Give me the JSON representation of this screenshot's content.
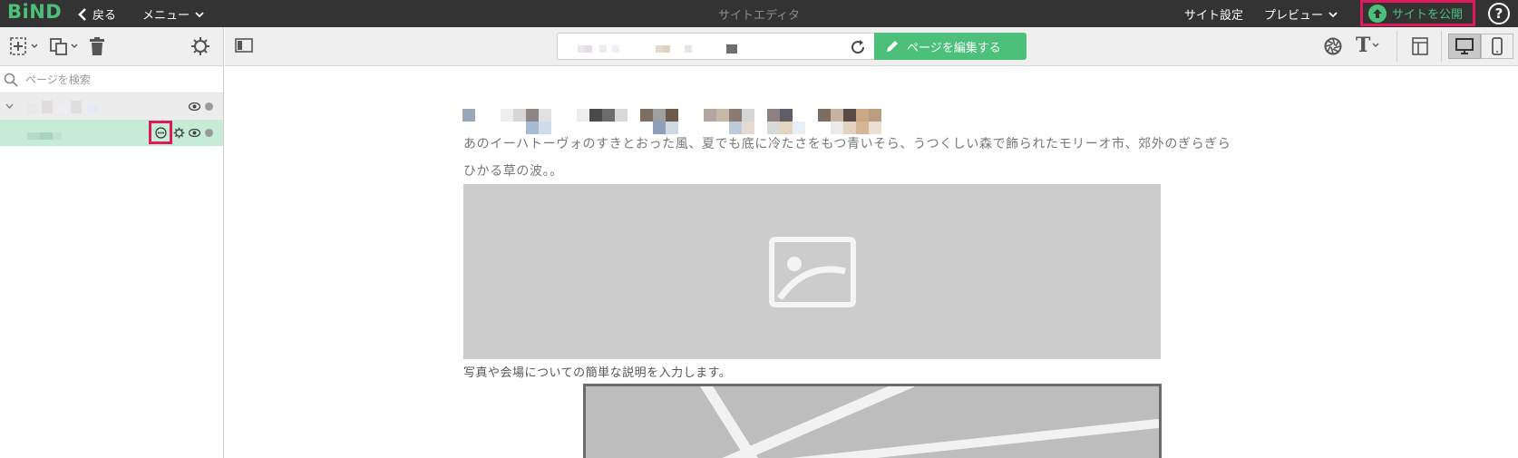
{
  "topbar": {
    "logo": "BiND",
    "back_label": "戻る",
    "menu_label": "メニュー",
    "app_title": "サイトエディタ",
    "site_settings_label": "サイト設定",
    "preview_label": "プレビュー",
    "publish_label": "サイトを公開",
    "help_label": "?"
  },
  "sidebar": {
    "search_placeholder": "ページを検索"
  },
  "editor_toolbar": {
    "edit_page_label": "ページを編集する"
  },
  "content": {
    "body_text": "あのイーハトーヴォのすきとおった風、夏でも底に冷たさをもつ青いそら、うつくしい森で飾られたモリーオ市、郊外のぎらぎらひかる草の波。。",
    "caption": "写真や会場についての簡単な説明を入力します。"
  },
  "colors": {
    "brand_green": "#4cc07a",
    "highlight": "#e0195a",
    "topbar_bg": "#333333",
    "selected_row": "#c6ecd7"
  }
}
